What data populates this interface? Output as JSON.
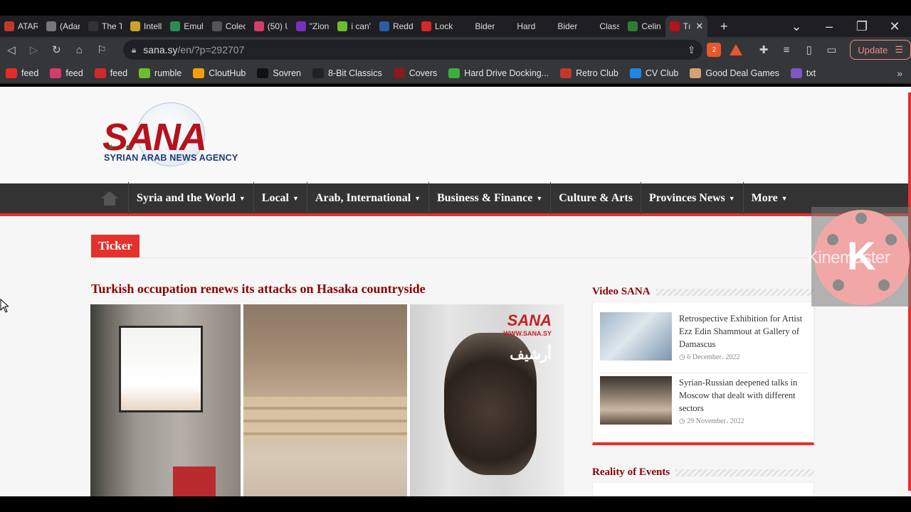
{
  "browser": {
    "tabs": [
      {
        "label": "ATAR",
        "icon": "atari-icon",
        "color": "#c0392b"
      },
      {
        "label": "(Adar",
        "icon": "globe-icon",
        "color": "#777777"
      },
      {
        "label": "The T",
        "icon": "book-icon",
        "color": "#333333"
      },
      {
        "label": "Intell",
        "icon": "person-icon",
        "color": "#c9a227"
      },
      {
        "label": "Emul",
        "icon": "globe-icon",
        "color": "#2e8b57"
      },
      {
        "label": "Colec",
        "icon": "columns-icon",
        "color": "#555555"
      },
      {
        "label": "(50) U",
        "icon": "flower-icon",
        "color": "#d63c6a"
      },
      {
        "label": "\"Zion",
        "icon": "play-icon",
        "color": "#7b2fbe"
      },
      {
        "label": "i can'",
        "icon": "rumble-icon",
        "color": "#6bbf2e"
      },
      {
        "label": "Redd",
        "icon": "news-icon",
        "color": "#2a5da8"
      },
      {
        "label": "Lock",
        "icon": "c-icon",
        "color": "#d62828"
      },
      {
        "label": "Bider",
        "icon": "",
        "color": "#1f1f23"
      },
      {
        "label": "Hard",
        "icon": "",
        "color": "#1f1f23"
      },
      {
        "label": "Bider",
        "icon": "",
        "color": "#1f1f23"
      },
      {
        "label": "Class",
        "icon": "",
        "color": "#1f1f23"
      },
      {
        "label": "Celin",
        "icon": "rt-icon",
        "color": "#2e7d32"
      },
      {
        "label": "Tı",
        "icon": "sana-icon",
        "color": "#b5121b",
        "active": true
      }
    ],
    "new_tab": "+",
    "tab_search": "⌄",
    "window_controls": {
      "minimize": "–",
      "restore": "❐",
      "close": "✕"
    },
    "url": {
      "domain": "sana.sy",
      "path": "/en/?p=292707"
    },
    "update_label": "Update",
    "brave_badge": "2",
    "rewards_badge": "1",
    "bookmarks": [
      {
        "label": "feed",
        "icon": "youtube-icon",
        "color": "#e52d27"
      },
      {
        "label": "feed",
        "icon": "flower-icon",
        "color": "#d63c6a"
      },
      {
        "label": "feed",
        "icon": "c-icon",
        "color": "#d62828"
      },
      {
        "label": "rumble",
        "icon": "rumble-icon",
        "color": "#6bbf2e"
      },
      {
        "label": "CloutHub",
        "icon": "clouthub-icon",
        "color": "#f59e0b"
      },
      {
        "label": "Sovren",
        "icon": "s-icon",
        "color": "#111111"
      },
      {
        "label": "8-Bit Classics",
        "icon": "ship-icon",
        "color": "#222222"
      },
      {
        "label": "Covers",
        "icon": "covers-icon",
        "color": "#8b1a1a"
      },
      {
        "label": "Hard Drive Docking...",
        "icon": "bag-icon",
        "color": "#3cae3c"
      },
      {
        "label": "Retro Club",
        "icon": "house-icon",
        "color": "#c0392b"
      },
      {
        "label": "CV Club",
        "icon": "cv-icon",
        "color": "#1e88e5"
      },
      {
        "label": "Good Deal Games",
        "icon": "gdg-icon",
        "color": "#d4a373"
      },
      {
        "label": "txt",
        "icon": "txt-icon",
        "color": "#7e57c2"
      }
    ],
    "bookmarks_more": "»"
  },
  "site": {
    "logo": {
      "name": "SANA",
      "subtitle": "SYRIAN ARAB NEWS AGENCY"
    },
    "nav": [
      {
        "label": "Syria and the World",
        "dropdown": true
      },
      {
        "label": "Local",
        "dropdown": true
      },
      {
        "label": "Arab, International",
        "dropdown": true
      },
      {
        "label": "Business & Finance",
        "dropdown": true
      },
      {
        "label": "Culture & Arts",
        "dropdown": false
      },
      {
        "label": "Provinces News",
        "dropdown": true
      },
      {
        "label": "More",
        "dropdown": true
      }
    ],
    "ticker_label": "Ticker",
    "article": {
      "title": "Turkish occupation renews its attacks on Hasaka countryside",
      "watermark": {
        "logo": "SANA",
        "url": "WWW.SANA.SY",
        "arabic": "أرشيف"
      }
    },
    "video_widget": {
      "title": "Video SANA",
      "items": [
        {
          "title": "Retrospective Exhibition for Artist Ezz Edin Shammout at Gallery of Damascus",
          "date": "6 December، 2022"
        },
        {
          "title": "Syrian-Russian deepened talks in Moscow that dealt with different sectors",
          "date": "29 November، 2022"
        }
      ]
    },
    "events_widget": {
      "title": "Reality of Events"
    }
  },
  "overlay": {
    "letter": "K",
    "text": "Kinemaster"
  },
  "colors": {
    "accent_red": "#e4312c",
    "headline_red": "#8b0000",
    "nav_bg": "#333333"
  }
}
